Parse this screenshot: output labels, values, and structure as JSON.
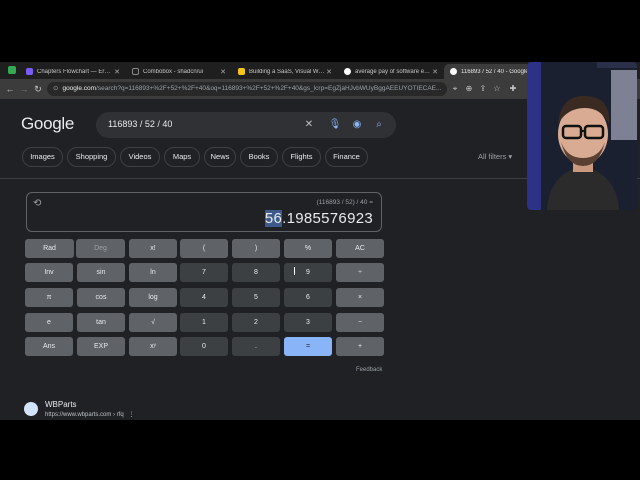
{
  "tabs": [
    {
      "title": "Chapters Flowchart — Eraser",
      "color": "#7a5af8"
    },
    {
      "title": "Combobox - shadcn/ui",
      "color": "#ffffff"
    },
    {
      "title": "Building a SaaS, Visual Work",
      "color": "#f5c518"
    },
    {
      "title": "average pay of software engi",
      "color": "#4285f4"
    },
    {
      "title": "116893 / 52 / 40 - Google",
      "color": "#4285f4"
    }
  ],
  "omnibox": {
    "host": "google.com",
    "path": "/search?q=116893+%2F+52+%2F+40&oq=116893+%2F+52+%2F+40&gs_lcrp=EgZjaHJvbWUyBggAEEUYOTIECAE..."
  },
  "google": {
    "logo": "Google",
    "query": "116893 / 52 / 40",
    "chips": [
      "Images",
      "Shopping",
      "Videos",
      "Maps",
      "News",
      "Books",
      "Flights",
      "Finance"
    ],
    "all_filters": "All filters ▾"
  },
  "calculator": {
    "expression": "(116893 / 52) / 40 =",
    "result_highlight": "56",
    "result_rest": ".1985576923",
    "rows": [
      [
        "Rad",
        "Deg",
        "x!",
        "(",
        ")",
        "%",
        "AC"
      ],
      [
        "Inv",
        "sin",
        "ln",
        "7",
        "8",
        "9",
        "÷"
      ],
      [
        "π",
        "cos",
        "log",
        "4",
        "5",
        "6",
        "×"
      ],
      [
        "e",
        "tan",
        "√",
        "1",
        "2",
        "3",
        "−"
      ],
      [
        "Ans",
        "EXP",
        "xʸ",
        "0",
        ".",
        "=",
        "+"
      ]
    ],
    "feedback": "Feedback"
  },
  "result": {
    "title": "WBParts",
    "url": "https://www.wbparts.com › rfq"
  }
}
